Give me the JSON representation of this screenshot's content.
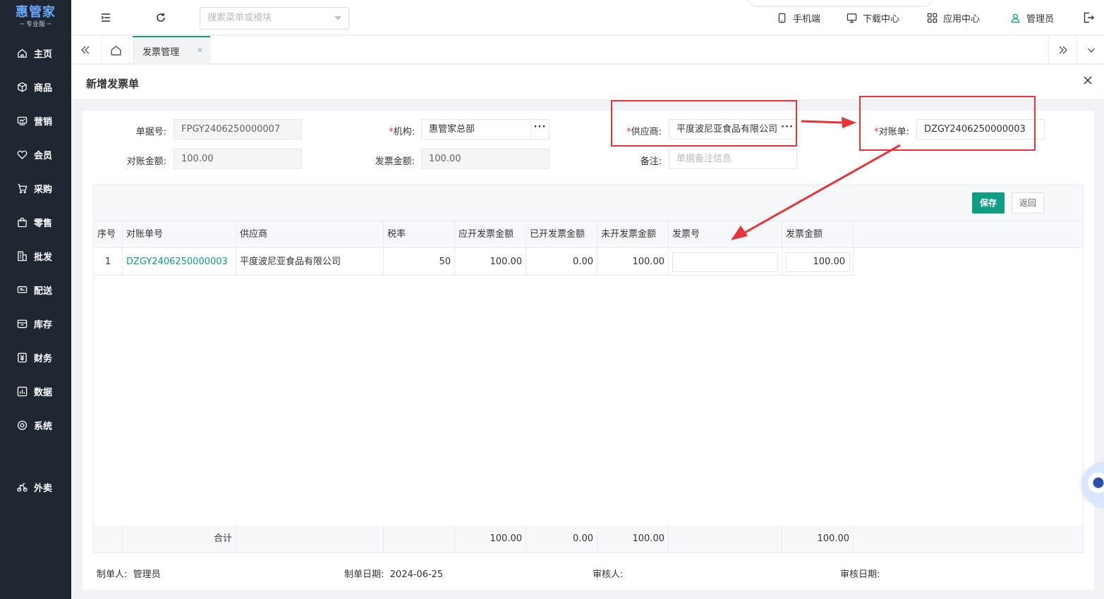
{
  "app": {
    "logo_main": "惠管家",
    "logo_sub": "─ 专业版 ─"
  },
  "sidebar": {
    "items": [
      {
        "label": "主页",
        "icon": "home-icon"
      },
      {
        "label": "商品",
        "icon": "cube-icon"
      },
      {
        "label": "营销",
        "icon": "chart-card-icon"
      },
      {
        "label": "会员",
        "icon": "heart-icon"
      },
      {
        "label": "采购",
        "icon": "cart-icon"
      },
      {
        "label": "零售",
        "icon": "bag-icon"
      },
      {
        "label": "批发",
        "icon": "building-icon"
      },
      {
        "label": "配送",
        "icon": "truck-icon"
      },
      {
        "label": "库存",
        "icon": "box-icon"
      },
      {
        "label": "财务",
        "icon": "money-icon"
      },
      {
        "label": "数据",
        "icon": "bar-chart-icon"
      },
      {
        "label": "系统",
        "icon": "settings-icon"
      },
      {
        "label": "外卖",
        "icon": "bike-icon"
      }
    ]
  },
  "topbar": {
    "search_placeholder": "搜索菜单或模块",
    "links": {
      "mobile": "手机端",
      "download": "下载中心",
      "apps": "应用中心",
      "user": "管理员"
    }
  },
  "tabs": {
    "active_label": "发票管理"
  },
  "page": {
    "title": "新增发票单"
  },
  "form": {
    "doc_no_label": "单据号:",
    "doc_no_value": "FPGY2406250000007",
    "org_label": "机构:",
    "org_value": "惠管家总部",
    "supplier_label": "供应商:",
    "supplier_value": "平度波尼亚食品有限公司",
    "statement_label": "对账单:",
    "statement_value": "DZGY2406250000003",
    "recon_amount_label": "对账金额:",
    "recon_amount_value": "100.00",
    "invoice_amount_label": "发票金额:",
    "invoice_amount_value": "100.00",
    "remark_label": "备注:",
    "remark_placeholder": "单据备注信息",
    "required_mark": "*",
    "dots": "···"
  },
  "toolbar": {
    "save_label": "保存",
    "back_label": "返回"
  },
  "table": {
    "columns": [
      "序号",
      "对账单号",
      "供应商",
      "税率",
      "应开发票金额",
      "已开发票金额",
      "未开发票金额",
      "发票号",
      "发票金额"
    ],
    "rows": [
      {
        "index": "1",
        "statement_no": "DZGY2406250000003",
        "supplier": "平度波尼亚食品有限公司",
        "tax_rate": "50",
        "due_amount": "100.00",
        "issued_amount": "0.00",
        "unissued_amount": "100.00",
        "invoice_no": "",
        "invoice_amount": "100.00"
      }
    ],
    "footer": {
      "label": "合计",
      "due_amount": "100.00",
      "issued_amount": "0.00",
      "unissued_amount": "100.00",
      "invoice_amount": "100.00"
    }
  },
  "meta": {
    "creator_label": "制单人:",
    "creator_value": "管理员",
    "created_date_label": "制单日期:",
    "created_date_value": "2024-06-25",
    "reviewer_label": "审核人:",
    "reviewer_value": "",
    "review_date_label": "审核日期:",
    "review_date_value": ""
  },
  "colors": {
    "primary": "#0f9d84",
    "sidebar_bg": "#1f2733",
    "annotation_red": "#e8323a"
  }
}
